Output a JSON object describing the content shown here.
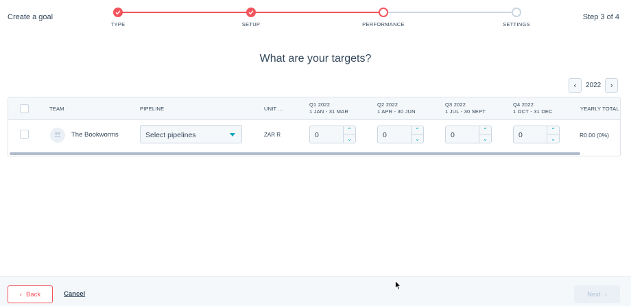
{
  "header": {
    "create_goal": "Create a goal",
    "step_count": "Step 3 of 4"
  },
  "stepper": {
    "steps": [
      {
        "label": "TYPE",
        "state": "done"
      },
      {
        "label": "SETUP",
        "state": "done"
      },
      {
        "label": "PERFORMANCE",
        "state": "current"
      },
      {
        "label": "SETTINGS",
        "state": "todo"
      }
    ]
  },
  "page_title": "What are your targets?",
  "year_nav": {
    "prev_icon": "chevron-left-icon",
    "year": "2022",
    "next_icon": "chevron-right-icon"
  },
  "table": {
    "headers": {
      "team": "TEAM",
      "pipeline": "PIPELINE",
      "unit": "UNIT ...",
      "q1": "Q1 2022",
      "q1_range": "1 JAN - 31 MAR",
      "q2": "Q2 2022",
      "q2_range": "1 APR - 30 JUN",
      "q3": "Q3 2022",
      "q3_range": "1 JUL - 30 SEPT",
      "q4": "Q4 2022",
      "q4_range": "1 OCT - 31 DEC",
      "yearly": "YEARLY TOTAL"
    },
    "rows": [
      {
        "team": "The Bookworms",
        "pipeline_placeholder": "Select pipelines",
        "unit": "ZAR R",
        "q1": "0",
        "q2": "0",
        "q3": "0",
        "q4": "0",
        "yearly": "R0.00 (0%)"
      }
    ]
  },
  "footer": {
    "back_label": "Back",
    "cancel_label": "Cancel",
    "next_label": "Next"
  },
  "colors": {
    "accent": "#f2545b",
    "teal": "#00a4bd",
    "text": "#33475b",
    "border": "#cbd6e2"
  }
}
